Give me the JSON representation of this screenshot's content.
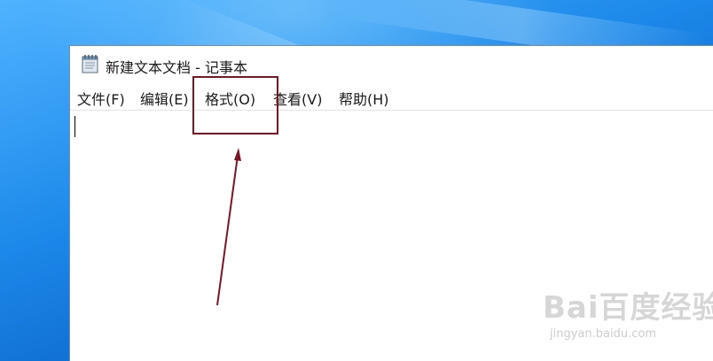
{
  "window": {
    "title": "新建文本文档 - 记事本",
    "icon": "notepad-icon"
  },
  "menubar": {
    "items": [
      {
        "label": "文件(F)"
      },
      {
        "label": "编辑(E)"
      },
      {
        "label": "格式(O)"
      },
      {
        "label": "查看(V)"
      },
      {
        "label": "帮助(H)"
      }
    ]
  },
  "editor": {
    "content": ""
  },
  "annotation": {
    "highlighted_menu": "格式(O)",
    "color": "#7a1526"
  },
  "watermark": {
    "logo": "Bai百度经验",
    "url": "jingyan.baidu.com"
  },
  "colors": {
    "desktop": "#1d89ea",
    "window_border": "#6f8fb8",
    "annotation": "#7a1526"
  }
}
